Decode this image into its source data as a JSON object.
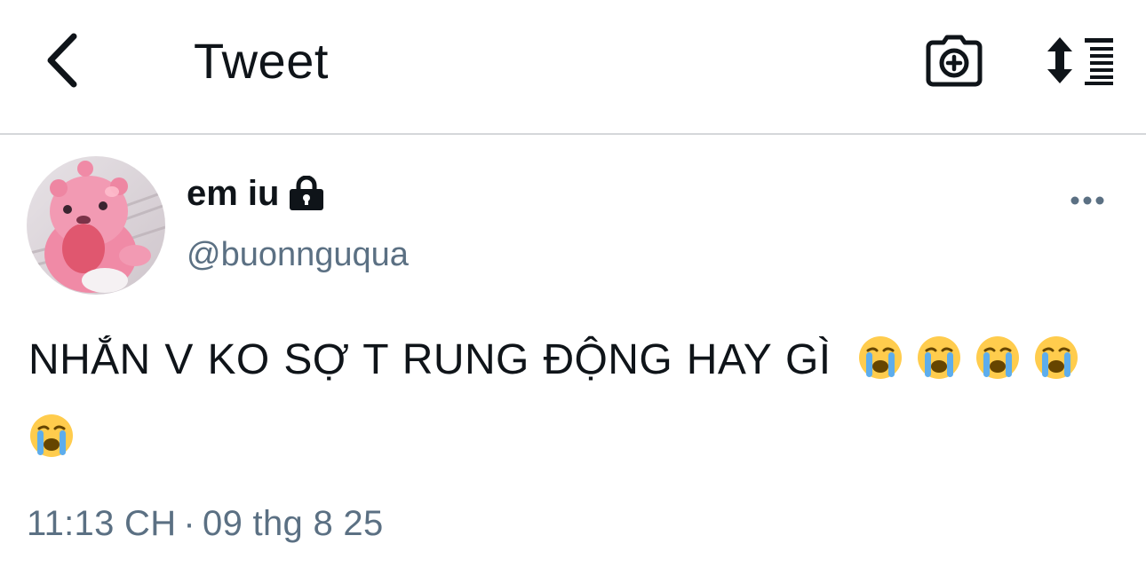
{
  "header": {
    "title": "Tweet",
    "back_icon": "chevron-left-icon",
    "camera_icon": "camera-add-icon",
    "sort_icon": "sort-list-icon"
  },
  "tweet": {
    "author": {
      "display_name": "em iu",
      "handle": "@buonnguqua",
      "protected": true,
      "avatar_icon": "pink-beaver-avatar"
    },
    "text_part": "NHẮN V KO SỢ T RUNG ĐỘNG HAY GÌ",
    "emoji": [
      "😭",
      "😭",
      "😭",
      "😭",
      "😭"
    ],
    "time": "11:13 CH",
    "separator": "·",
    "date": "09 thg 8 25"
  },
  "colors": {
    "text_primary": "#0f1419",
    "text_secondary": "#5b7083",
    "divider": "#d5d7da",
    "avatar_pink": "#f08aa6"
  }
}
